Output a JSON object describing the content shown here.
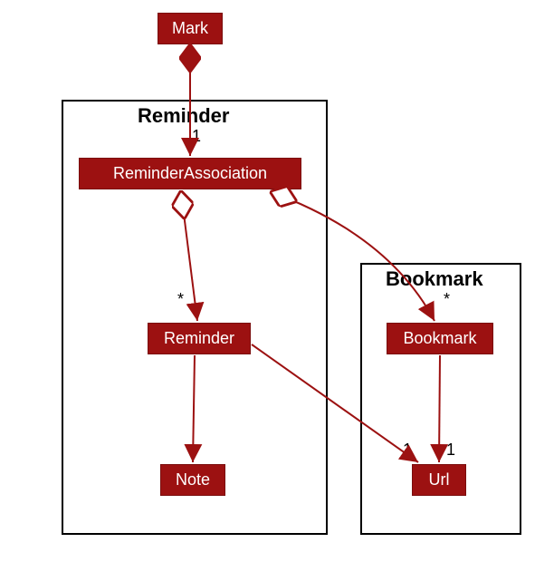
{
  "packages": {
    "reminder": {
      "title": "Reminder"
    },
    "bookmark": {
      "title": "Bookmark"
    }
  },
  "classes": {
    "mark": {
      "name": "Mark"
    },
    "reminderAssociation": {
      "name": "ReminderAssociation"
    },
    "reminder": {
      "name": "Reminder"
    },
    "note": {
      "name": "Note"
    },
    "bookmark": {
      "name": "Bookmark"
    },
    "url": {
      "name": "Url"
    }
  },
  "multiplicities": {
    "markToRA": "1",
    "raToReminder": "*",
    "raToBookmark": "*",
    "reminderToUrl": "1",
    "bookmarkToUrl": "1"
  }
}
